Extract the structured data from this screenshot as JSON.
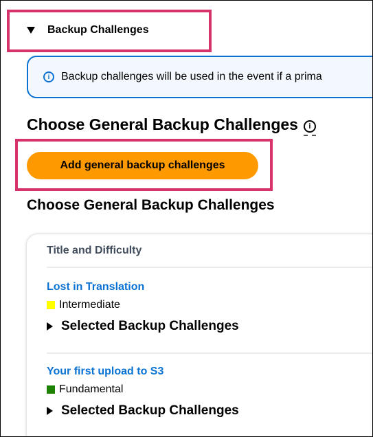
{
  "section": {
    "title": "Backup Challenges"
  },
  "banner": {
    "icon": "info-icon",
    "text": "Backup challenges will be used in the event if a prima"
  },
  "choose_heading": "Choose General Backup Challenges",
  "add_button_label": "Add general backup challenges",
  "choose_heading_2": "Choose General Backup Challenges",
  "table": {
    "header": "Title and Difficulty",
    "rows": [
      {
        "title": "Lost in Translation",
        "difficulty": "Intermediate",
        "difficulty_color": "#ffff00",
        "expand_label": "Selected Backup Challenges"
      },
      {
        "title": "Your first upload to S3",
        "difficulty": "Fundamental",
        "difficulty_color": "#1d8102",
        "expand_label": "Selected Backup Challenges"
      }
    ]
  },
  "colors": {
    "accent_orange": "#ff9900",
    "link_blue": "#0972d3",
    "highlight_pink": "#d6336c"
  }
}
